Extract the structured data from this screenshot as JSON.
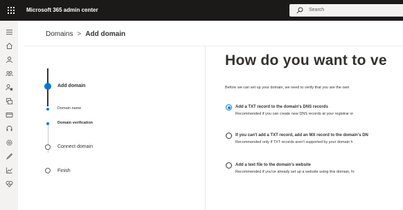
{
  "header": {
    "app_title": "Microsoft 365 admin center",
    "search_placeholder": "Search"
  },
  "rail": {
    "icons": [
      "menu-icon",
      "home-icon",
      "user-icon",
      "group-icon",
      "roles-icon",
      "resources-icon",
      "billing-icon",
      "support-icon",
      "settings-icon",
      "setup-icon",
      "reports-icon",
      "health-icon"
    ]
  },
  "breadcrumb": {
    "parent": "Domains",
    "separator": ">",
    "current": "Add domain"
  },
  "steps": {
    "add_domain": "Add domain",
    "domain_name": "Domain name",
    "domain_verification": "Domain verification",
    "connect_domain": "Connect domain",
    "finish": "Finish"
  },
  "main": {
    "heading": "How do you want to ve",
    "intro": "Before we can set up your domain, we need to verify that you are the own",
    "options": [
      {
        "title": "Add a TXT record to the domain's DNS records",
        "description": "Recommended if you can create new DNS records at your registrar or",
        "selected": true
      },
      {
        "title": "If you can't add a TXT record, add an MX record to the domain's DN",
        "description": "Recommended only if TXT records aren't supported by your domain h",
        "selected": false
      },
      {
        "title": "Add a text file to the domain's website",
        "description": "Recommended if you've already set up a website using this domain, fo",
        "selected": false
      }
    ]
  },
  "colors": {
    "topbar": "#1b1a19",
    "accent": "#0078d4",
    "rail": "#f3f2f1",
    "text": "#323130"
  }
}
